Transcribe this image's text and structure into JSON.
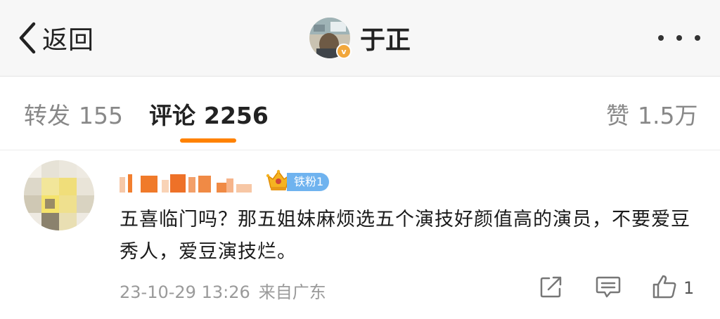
{
  "header": {
    "back_label": "返回",
    "title": "于正",
    "verified_badge": "v",
    "more_icon": "more-horizontal-icon"
  },
  "tabs": [
    {
      "label": "转发",
      "count": "155"
    },
    {
      "label": "评论",
      "count": "2256"
    },
    {
      "label": "赞",
      "count": "1.5万"
    }
  ],
  "colors": {
    "accent": "#ff8200",
    "verified": "#f2a73b",
    "fan_badge": "#6fb3ef"
  },
  "comment": {
    "fan_badge_label": "铁粉1",
    "text": "五喜临门吗？那五姐妹麻烦选五个演技好颜值高的演员，不要爱豆秀人，爱豆演技烂。",
    "timestamp": "23-10-29 13:26",
    "source": "来自广东",
    "like_count": "1",
    "icons": [
      "share-icon",
      "reply-comment-icon",
      "like-icon"
    ]
  }
}
